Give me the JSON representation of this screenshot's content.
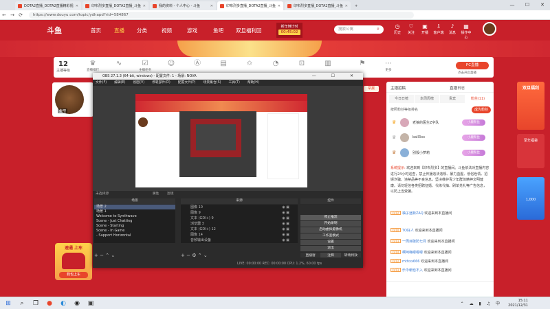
{
  "browser": {
    "tabs": [
      {
        "label": "DOTA2直播_DOTA2直播精彩视",
        "active": false
      },
      {
        "label": "印布烈多直播_DOTA2直播_斗鱼",
        "active": false
      },
      {
        "label": "我的资料 - 个人中心 - 斗鱼",
        "active": false
      },
      {
        "label": "印布烈多直播_DOTA2直播_斗鱼",
        "active": true
      },
      {
        "label": "印布烈多直播_DOTA2直播_斗鱼",
        "active": false
      }
    ],
    "url": "https://www.douyu.com/topic/ydhapd?rid=584867"
  },
  "site": {
    "logo": "斗鱼",
    "nav": [
      "首页",
      "直播",
      "分类",
      "视频",
      "游戏",
      "鱼吧",
      "双旦福利回"
    ],
    "nav_highlight": 1,
    "countdown_label": "新年倒计时",
    "countdown_time": "00:45:02",
    "search_placeholder": "搜索公寓",
    "icons": [
      {
        "label": "历史",
        "icon": "clock-icon"
      },
      {
        "label": "关注",
        "icon": "heart-icon"
      },
      {
        "label": "开播",
        "icon": "camera-icon"
      },
      {
        "label": "客户端",
        "icon": "download-icon"
      },
      {
        "label": "消息",
        "icon": "bell-icon"
      },
      {
        "label": "操作中心",
        "icon": "grid-icon"
      }
    ]
  },
  "gamebar": {
    "level_value": "12",
    "level_label": "主播等级",
    "items": [
      {
        "label": "直播排行",
        "icon": "trophy-icon"
      },
      {
        "label": "",
        "icon": "wave-icon"
      },
      {
        "label": "主播任务",
        "icon": "task-icon"
      },
      {
        "label": "",
        "icon": "people-icon"
      },
      {
        "label": "",
        "icon": "ad-icon"
      },
      {
        "label": "",
        "icon": "gift-icon"
      },
      {
        "label": "",
        "icon": "star-icon"
      },
      {
        "label": "",
        "icon": "clock-icon"
      },
      {
        "label": "",
        "icon": "lock-icon"
      },
      {
        "label": "主播亲密度统计",
        "icon": "chart-icon"
      },
      {
        "label": "直播任务",
        "icon": "flag-icon"
      },
      {
        "label": "更多",
        "icon": "more-icon"
      }
    ],
    "pc_button": "PC直播",
    "pc_hint": "点击开启直播"
  },
  "room": {
    "report": "举报",
    "streamer_tag": "鱼吧",
    "follow": "关注"
  },
  "obs": {
    "title": "OBS 27.1.3 (64-bit, windows) - 配置文件: 1 - 场景: NOVA",
    "window_controls": "— ☐ ✕",
    "menu": [
      "文件(F)",
      "编辑(E)",
      "视图(V)",
      "停靠部件(D)",
      "配置文件(P)",
      "场景集合(S)",
      "工具(T)",
      "帮助(H)"
    ],
    "mixer_label": "未选择源",
    "props_label": "属性",
    "filters_label": "滤镜",
    "scenes_header": "场景",
    "sources_header": "来源",
    "controls_header": "控件",
    "scenes": [
      "场景 2",
      "场景 1",
      "Welcome to Synthwave",
      "Scene - Just Chatting",
      "Scene - Starting",
      "Scene - In Game",
      "- Support Horizontal"
    ],
    "sources": [
      "图像 10",
      "图像 9",
      "文本 (GDI+) 9",
      "浏览器 3",
      "文本 (GDI+) 12",
      "图像 14",
      "音频输出设备"
    ],
    "controls": [
      "停止推流",
      "开始录制",
      "启动虚拟摄像机",
      "工作室模式",
      "设置",
      "退出"
    ],
    "dock_tabs": [
      "直播窗",
      "注释",
      "转场特效"
    ],
    "status": "LIVE: 00:00:00    REC: 00:00:00    CPU: 1.2%, 60.00 fps"
  },
  "chat": {
    "tabs": [
      "今日日榜",
      "本周周榜",
      "贵宾",
      "粉丝(11)"
    ],
    "header_left": "主播招稿",
    "header_right": "直播日志",
    "ranking_title": "按照粉丝等级排名",
    "fan_button": "成为粉丝",
    "ranks": [
      {
        "name": "老狼的医生Z字队",
        "badge": "小鹿粉丝"
      },
      {
        "name": "ball3xx",
        "badge": "小鹿粉丝"
      },
      {
        "name": "别毁小萝莉",
        "badge": "小鹿粉丝"
      }
    ],
    "system_label": "系统提示:",
    "system_text": "欢迎来到【印布烈多】的直播间。斗鱼依法对直播内容进行24小时巡查，禁止传播违法违规、暴力血腥、低俗色情、招嫖诈骗、违禁品等不良信息，坚决维护青少年群体精神文明健康。请勿轻信各类招聘征婚、代练代抽、刷单兑礼等广告信息，以防上当受骗。",
    "messages": [
      {
        "level": "LV12",
        "user": "柚子迷新ZAQ",
        "text": "欢迎来到本直播间"
      },
      {
        "level": "LV10",
        "user": "TO好人",
        "text": "欢迎来到本直播间"
      },
      {
        "level": "LV13",
        "user": "一周目破防七月",
        "text": "欢迎来到本直播间"
      },
      {
        "level": "LV14",
        "user": "啊呵嗨嗯嗯嗯",
        "text": "欢迎来到本直播间"
      },
      {
        "level": "LV12",
        "user": "mthxx666",
        "text": "欢迎来到本直播间"
      },
      {
        "level": "LV13",
        "user": "乐今朝也不入",
        "text": "欢迎来到本直播间"
      }
    ]
  },
  "right_ads": [
    {
      "title": "双旦福利",
      "sub": "至年福袋",
      "color": "#e8452b"
    },
    {
      "title": "至年福袋",
      "sub": "1,000",
      "color": "#d8343a"
    }
  ],
  "ad": {
    "title": "速通 上车",
    "button": "我也上车"
  },
  "taskbar": {
    "time": "15:11",
    "date": "2021/12/31"
  }
}
